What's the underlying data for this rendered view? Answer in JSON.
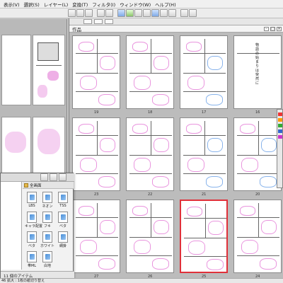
{
  "menubar": {
    "items": [
      "表示(V)",
      "選択(S)",
      "レイヤー(L)",
      "変換(T)",
      "フィルタ(I)",
      "ウィンドウ(W)",
      "ヘルプ(H)"
    ]
  },
  "document": {
    "title": "作品"
  },
  "pages": [
    {
      "num": "19"
    },
    {
      "num": "18"
    },
    {
      "num": "17"
    },
    {
      "num": "16"
    },
    {
      "num": "23"
    },
    {
      "num": "22"
    },
    {
      "num": "21"
    },
    {
      "num": "20"
    },
    {
      "num": "27"
    },
    {
      "num": "26"
    },
    {
      "num": "25"
    },
    {
      "num": "24"
    }
  ],
  "page16_vertical_text": "物語の始まりは突然に",
  "material": {
    "header_label": "全画面",
    "items": [
      {
        "label": "LBS"
      },
      {
        "label": "ネオン"
      },
      {
        "label": "TSS"
      },
      {
        "label": "キャラ配置"
      },
      {
        "label": "フキ"
      },
      {
        "label": "ベタ"
      },
      {
        "label": "ベタ"
      },
      {
        "label": "ホワイト"
      },
      {
        "label": "網掛"
      },
      {
        "label": "帯ML"
      },
      {
        "label": "白地"
      }
    ],
    "footer": "11 個のアイテム"
  },
  "statusbar": {
    "text": "46  拡大 : 1枚の紙切り替え"
  },
  "colors": {
    "selected_page_border": "#e0303a",
    "sketch_pink": "#e37ad6",
    "sketch_blue": "#6aa0e6"
  }
}
